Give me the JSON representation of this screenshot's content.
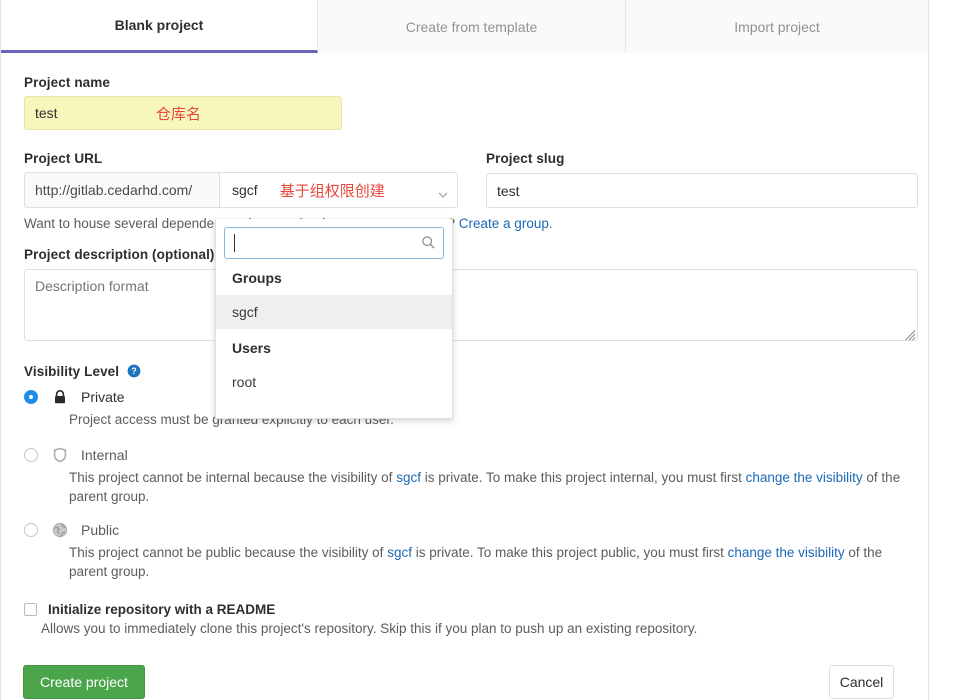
{
  "tabs": [
    {
      "label": "Blank project",
      "active": true
    },
    {
      "label": "Create from template",
      "active": false
    },
    {
      "label": "Import project",
      "active": false
    }
  ],
  "form": {
    "project_name": {
      "label": "Project name",
      "value": "test",
      "annotation": "仓库名"
    },
    "project_url": {
      "label": "Project URL",
      "prefix": "http://gitlab.cedarhd.com/",
      "namespace_value": "sgcf",
      "annotation": "基于组权限创建"
    },
    "project_slug": {
      "label": "Project slug",
      "value": "test"
    },
    "namespace_hint": {
      "text_before": "Want to house several dependent projects under the same namespace? ",
      "link": "Create a group."
    },
    "description": {
      "label": "Project description (optional)",
      "placeholder": "Description format",
      "value": ""
    },
    "visibility": {
      "label": "Visibility Level",
      "help_icon": "question-circle-icon",
      "options": [
        {
          "name": "Private",
          "icon": "lock-icon",
          "selected": true,
          "disabled": false,
          "description": "Project access must be granted explicitly to each user."
        },
        {
          "name": "Internal",
          "icon": "shield-icon",
          "selected": false,
          "disabled": true,
          "desc_part1": "This project cannot be internal because the visibility of ",
          "desc_group": "sgcf",
          "desc_part2": " is private. To make this project internal, you must first ",
          "desc_link": "change the visibility",
          "desc_part3": " of the parent group."
        },
        {
          "name": "Public",
          "icon": "globe-icon",
          "selected": false,
          "disabled": true,
          "desc_part1": "This project cannot be public because the visibility of ",
          "desc_group": "sgcf",
          "desc_part2": " is private. To make this project public, you must first ",
          "desc_link": "change the visibility",
          "desc_part3": " of the parent group."
        }
      ]
    },
    "readme": {
      "label": "Initialize repository with a README",
      "checked": false,
      "description": "Allows you to immediately clone this project's repository. Skip this if you plan to push up an existing repository."
    }
  },
  "namespace_dropdown": {
    "open": true,
    "search_placeholder": "",
    "search_value": "",
    "search_icon": "search-icon",
    "sections": [
      {
        "header": "Groups",
        "items": [
          {
            "label": "sgcf",
            "highlighted": true
          }
        ]
      },
      {
        "header": "Users",
        "items": [
          {
            "label": "root",
            "highlighted": false
          }
        ]
      }
    ]
  },
  "footer": {
    "create_label": "Create project",
    "cancel_label": "Cancel"
  },
  "colors": {
    "accent_tab": "#6b64bd",
    "primary_button": "#4ba64b",
    "link": "#1b69b6",
    "annotation": "#e8483c",
    "autofill": "#f7f7bd",
    "radio_selected": "#1f8ceb"
  }
}
